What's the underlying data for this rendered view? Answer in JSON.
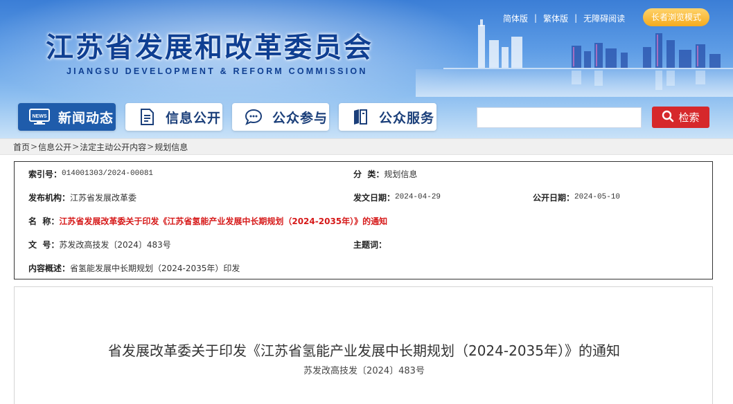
{
  "header": {
    "site_title": "江苏省发展和改革委员会",
    "site_subtitle": "JIANGSU DEVELOPMENT & REFORM COMMISSION",
    "top_links": [
      "简体版",
      "繁体版",
      "无障碍阅读"
    ],
    "elder_mode": "长者浏览模式"
  },
  "nav": {
    "tabs": [
      {
        "label": "新闻动态",
        "icon": "news-icon",
        "active": true
      },
      {
        "label": "信息公开",
        "icon": "document-icon",
        "active": false
      },
      {
        "label": "公众参与",
        "icon": "chat-icon",
        "active": false
      },
      {
        "label": "公众服务",
        "icon": "book-icon",
        "active": false
      }
    ],
    "search": {
      "value": "",
      "placeholder": "",
      "button_label": "检索"
    },
    "news_icon_text": "NEWS"
  },
  "breadcrumb": [
    "首页",
    "信息公开",
    "法定主动公开内容",
    "规划信息"
  ],
  "info": {
    "index_label": "索引号：",
    "index_value": "014001303/2024-00081",
    "category_label": "分  类：",
    "category_value": "规划信息",
    "publisher_label": "发布机构：",
    "publisher_value": "江苏省发展改革委",
    "issue_date_label": "发文日期：",
    "issue_date_value": "2024-04-29",
    "public_date_label": "公开日期：",
    "public_date_value": "2024-05-10",
    "name_label": "名  称：",
    "name_value": "江苏省发展改革委关于印发《江苏省氢能产业发展中长期规划（2024-2035年）》的通知",
    "docno_label": "文  号：",
    "docno_value": "苏发改高技发〔2024〕483号",
    "keywords_label": "主题词：",
    "keywords_value": "",
    "summary_label": "内容概述：",
    "summary_value": "省氢能发展中长期规划（2024-2035年）印发"
  },
  "article": {
    "title": "省发展改革委关于印发《江苏省氢能产业发展中长期规划（2024-2035年）》的通知",
    "doc_number": "苏发改高技发〔2024〕483号"
  },
  "colors": {
    "banner_top": "#3b7ed6",
    "title_blue": "#0f3f92",
    "nav_active": "#1f5cab",
    "search_red": "#d6282b",
    "elder_orange": "#f5ab1d",
    "name_red": "#d61a1a"
  }
}
